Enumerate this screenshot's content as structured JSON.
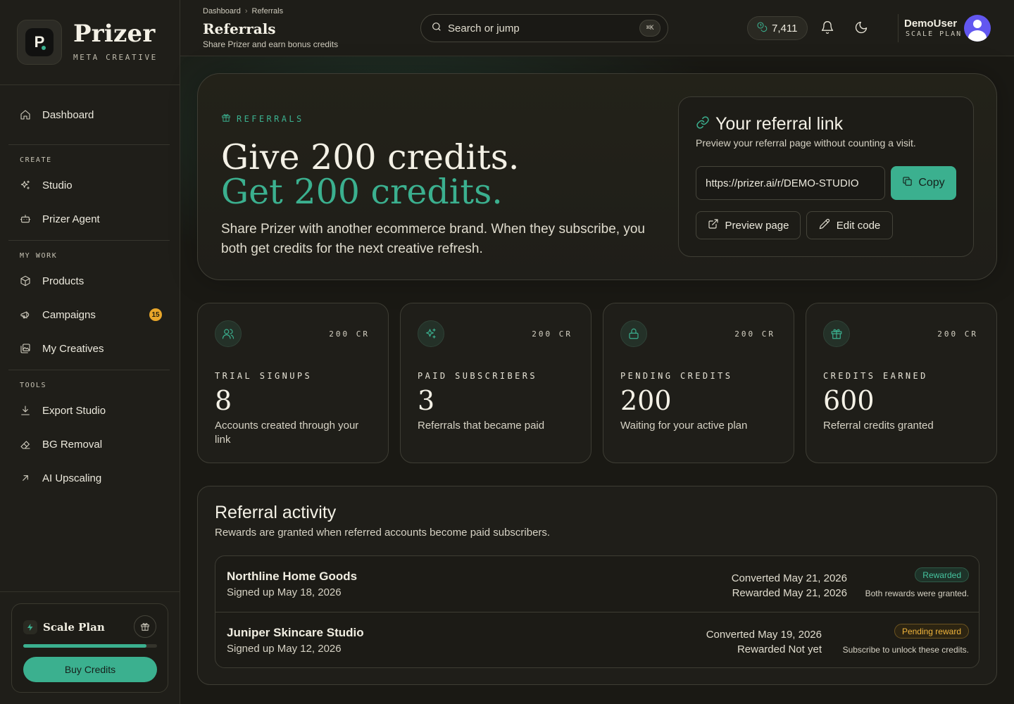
{
  "brand": {
    "name": "Prizer",
    "sub": "META CREATIVE",
    "logo_letter": "P"
  },
  "sidebar": {
    "dashboard": "Dashboard",
    "sections": {
      "create": "CREATE",
      "my_work": "MY WORK",
      "tools": "TOOLS"
    },
    "items": {
      "studio": "Studio",
      "agent": "Prizer Agent",
      "products": "Products",
      "campaigns": "Campaigns",
      "campaigns_badge": "15",
      "creatives": "My Creatives",
      "export": "Export Studio",
      "bg_removal": "BG Removal",
      "upscaling": "AI Upscaling"
    },
    "plan": {
      "name": "Scale Plan",
      "usage_fraction": 0.92,
      "buy_label": "Buy Credits"
    }
  },
  "topbar": {
    "breadcrumb": [
      "Dashboard",
      "Referrals"
    ],
    "title": "Referrals",
    "subtitle": "Share Prizer and earn bonus credits",
    "search_placeholder": "Search or jump",
    "search_kbd": "⌘K",
    "credits": "7,411",
    "user_name": "DemoUser",
    "user_plan": "SCALE PLAN"
  },
  "hero": {
    "tag": "REFERRALS",
    "headline_1": "Give 200 credits.",
    "headline_2": "Get 200 credits.",
    "description": "Share Prizer with another ecommerce brand. When they subscribe, you both get credits for the next creative refresh."
  },
  "link_card": {
    "title": "Your referral link",
    "subtitle": "Preview your referral page without counting a visit.",
    "url": "https://prizer.ai/r/DEMO-STUDIO",
    "copy_label": "Copy",
    "preview_label": "Preview page",
    "edit_label": "Edit code"
  },
  "stats": [
    {
      "cr": "200 CR",
      "label": "TRIAL SIGNUPS",
      "value": "8",
      "desc": "Accounts created through your link",
      "icon": "users-icon"
    },
    {
      "cr": "200 CR",
      "label": "PAID SUBSCRIBERS",
      "value": "3",
      "desc": "Referrals that became paid",
      "icon": "sparkles-icon"
    },
    {
      "cr": "200 CR",
      "label": "PENDING CREDITS",
      "value": "200",
      "desc": "Waiting for your active plan",
      "icon": "lock-icon"
    },
    {
      "cr": "200 CR",
      "label": "CREDITS EARNED",
      "value": "600",
      "desc": "Referral credits granted",
      "icon": "gift-icon"
    }
  ],
  "activity": {
    "title": "Referral activity",
    "subtitle": "Rewards are granted when referred accounts become paid subscribers.",
    "rows": [
      {
        "name": "Northline Home Goods",
        "signed": "Signed up May 18, 2026",
        "converted": "Converted May 21, 2026",
        "rewarded": "Rewarded May 21, 2026",
        "badge": "Rewarded",
        "note": "Both rewards were granted."
      },
      {
        "name": "Juniper Skincare Studio",
        "signed": "Signed up May 12, 2026",
        "converted": "Converted May 19, 2026",
        "rewarded": "Rewarded Not yet",
        "badge": "Pending reward",
        "note": "Subscribe to unlock these credits."
      }
    ]
  },
  "colors": {
    "accent": "#3bb08f",
    "background": "#1c1b16",
    "pending": "#f0b43b",
    "badge": "#e8a62a"
  }
}
